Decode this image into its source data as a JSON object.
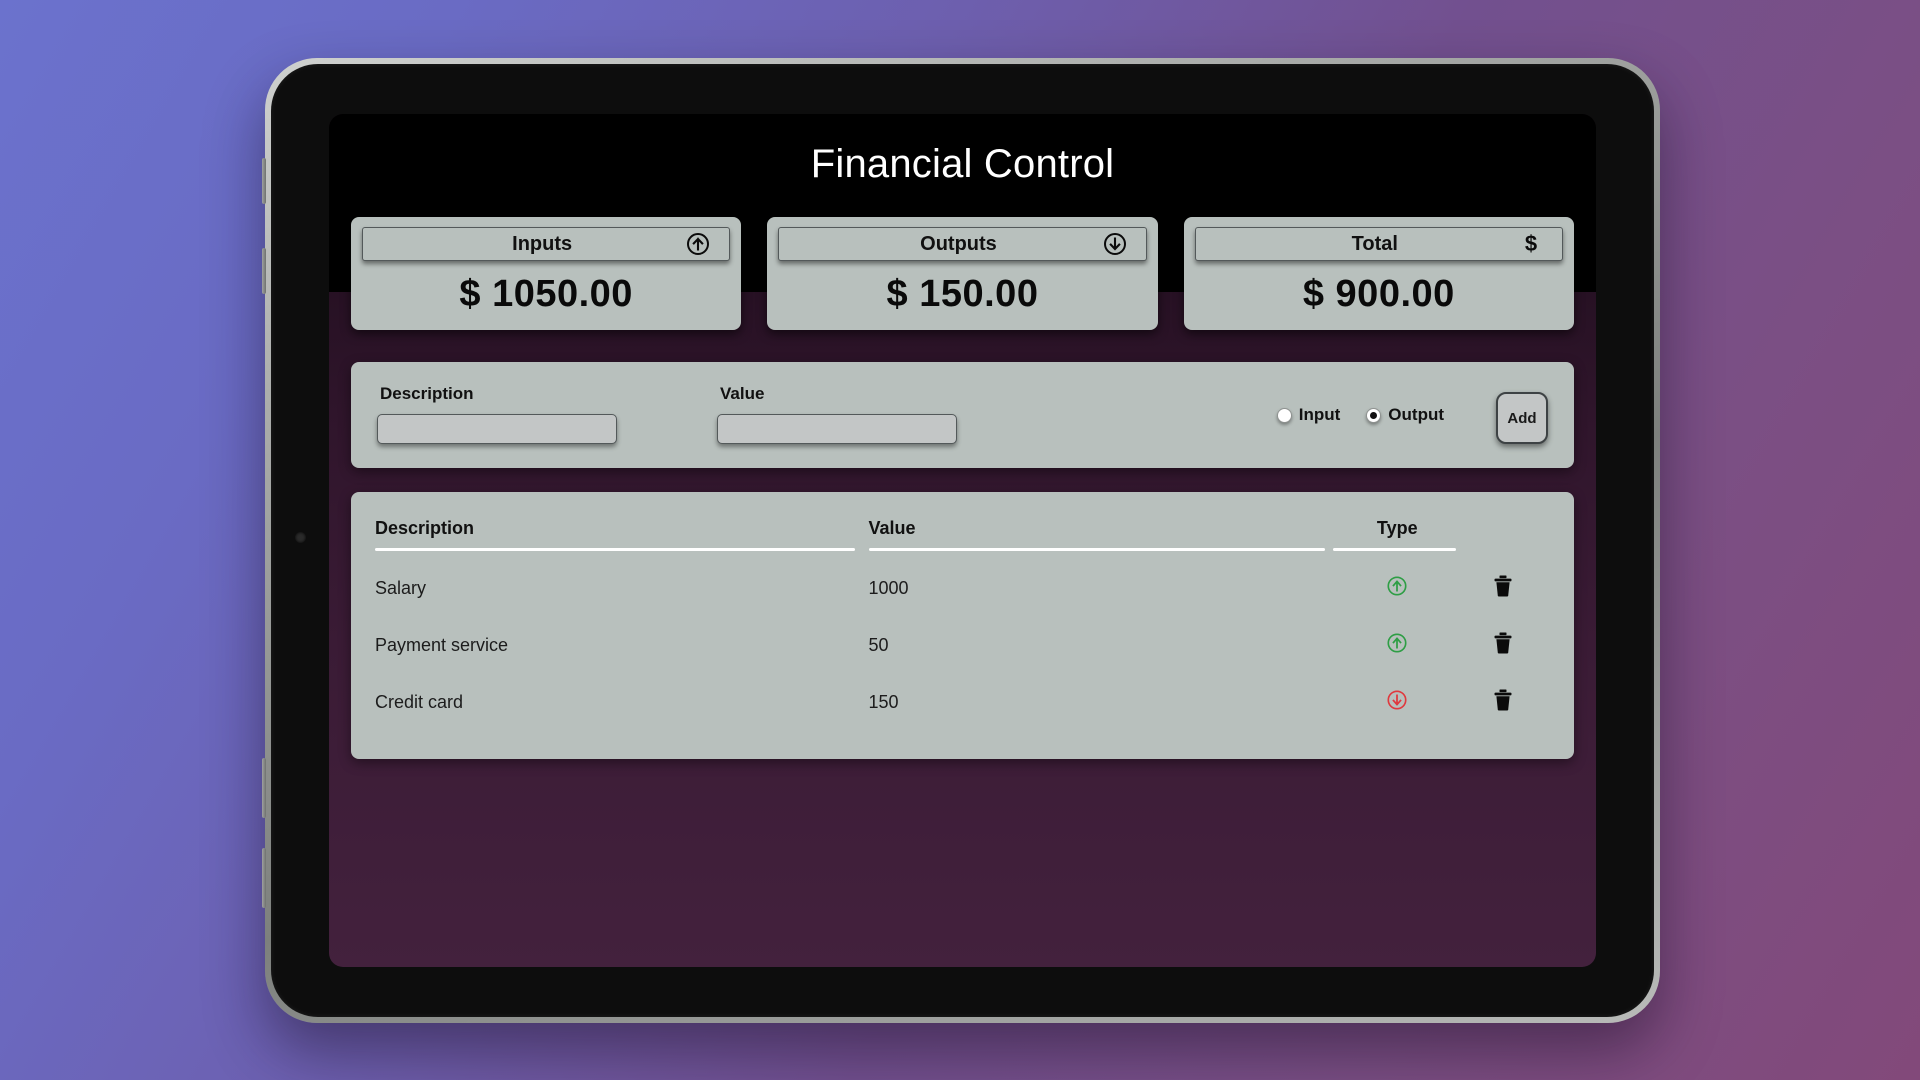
{
  "app": {
    "title": "Financial Control"
  },
  "summary": {
    "cards": [
      {
        "label": "Inputs",
        "icon": "arrow-up-circle-icon",
        "value": "$ 1050.00"
      },
      {
        "label": "Outputs",
        "icon": "arrow-down-circle-icon",
        "value": "$ 150.00"
      },
      {
        "label": "Total",
        "icon": "dollar-sign-icon",
        "value": "$ 900.00"
      }
    ]
  },
  "form": {
    "description_label": "Description",
    "description_value": "",
    "description_placeholder": "",
    "value_label": "Value",
    "value_value": "",
    "value_placeholder": "",
    "radios": [
      {
        "label": "Input",
        "checked": false
      },
      {
        "label": "Output",
        "checked": true
      }
    ],
    "add_label": "Add"
  },
  "table": {
    "columns": [
      "Description",
      "Value",
      "Type",
      ""
    ],
    "rows": [
      {
        "description": "Salary",
        "value": "1000",
        "type": "input",
        "delete_icon": "trash-icon"
      },
      {
        "description": "Payment service",
        "value": "50",
        "type": "input",
        "delete_icon": "trash-icon"
      },
      {
        "description": "Credit card",
        "value": "150",
        "type": "output",
        "delete_icon": "trash-icon"
      }
    ]
  },
  "colors": {
    "header_bg": "#000000",
    "panel_bg": "#b8c0bd",
    "body_gradient_top": "#140712",
    "body_gradient_bottom": "#43213d",
    "input_green": "#2e9e45",
    "output_red": "#e0393e",
    "text_dark": "#111111"
  }
}
